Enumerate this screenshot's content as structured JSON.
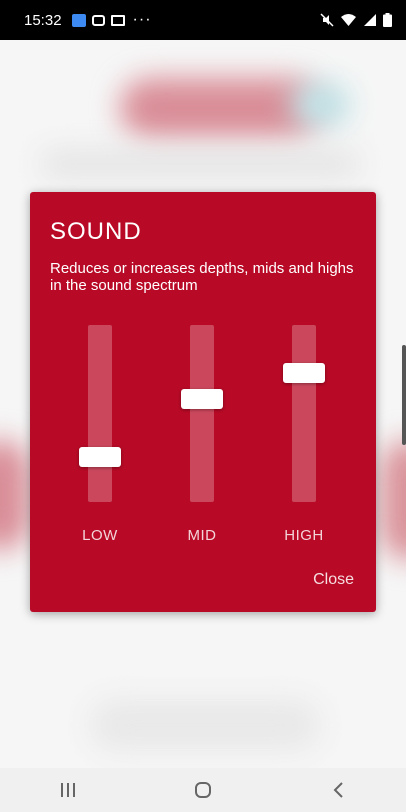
{
  "status_bar": {
    "time": "15:32",
    "overflow": "···",
    "left_icons": [
      "app-notification-icon",
      "chat-icon",
      "gallery-icon"
    ],
    "right_icons": [
      "mute-icon",
      "wifi-icon",
      "signal-icon",
      "battery-icon"
    ]
  },
  "dialog": {
    "title": "SOUND",
    "description": "Reduces or increases depths, mids and highs in the sound spectrum",
    "background_color": "#b80a26",
    "bands": [
      {
        "label": "LOW",
        "level": 0.22
      },
      {
        "label": "MID",
        "level": 0.59
      },
      {
        "label": "HIGH",
        "level": 0.76
      }
    ],
    "close_label": "Close"
  },
  "nav_bar": {
    "buttons": [
      "recents-icon",
      "home-icon",
      "back-icon"
    ]
  }
}
